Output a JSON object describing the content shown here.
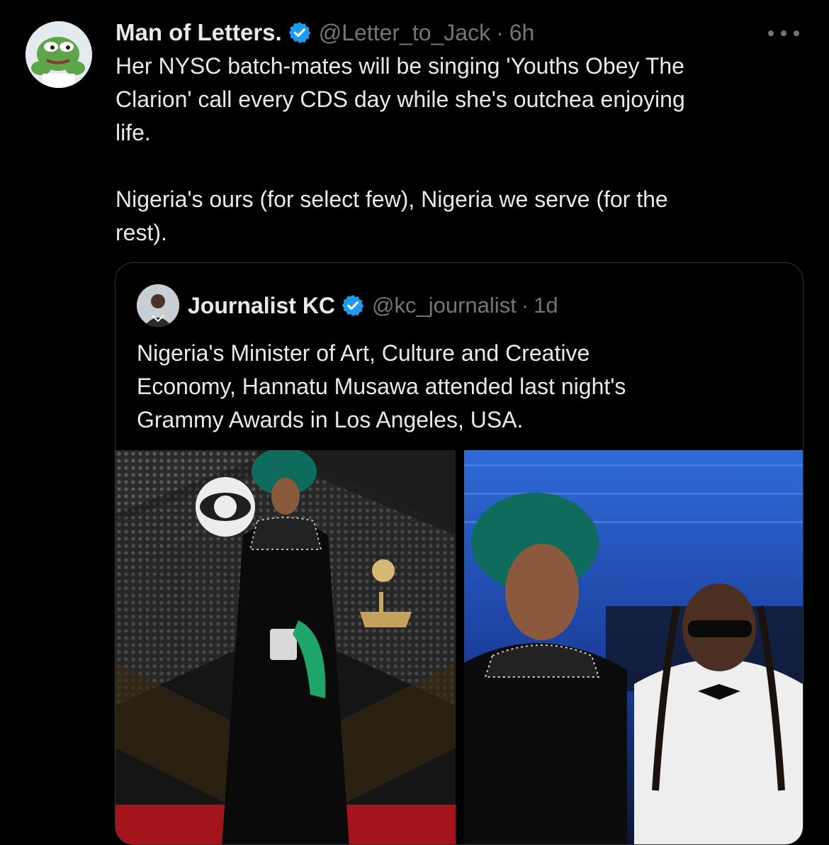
{
  "tweet": {
    "display_name": "Man of Letters.",
    "handle": "@Letter_to_Jack",
    "separator": "·",
    "time": "6h",
    "text_lines": [
      "Her NYSC batch-mates will be singing 'Youths Obey The",
      "Clarion' call every CDS day while she's outchea enjoying",
      "life.",
      "",
      "Nigeria's ours (for select few), Nigeria we serve (for the",
      "rest)."
    ]
  },
  "quoted_tweet": {
    "display_name": "Journalist KC",
    "handle": "@kc_journalist",
    "separator": "·",
    "time": "1d",
    "text_lines": [
      "Nigeria's Minister of Art, Culture and Creative",
      "Economy, Hannatu Musawa attended last night's",
      "Grammy Awards in Los Angeles, USA."
    ]
  },
  "icons": {
    "verified": "verified-badge-icon",
    "more": "more-options-icon"
  },
  "colors": {
    "background": "#000000",
    "primary_text": "#e7e9ea",
    "secondary_text": "#71767b",
    "verified_blue": "#1d9bf0",
    "border": "#2f3336"
  }
}
